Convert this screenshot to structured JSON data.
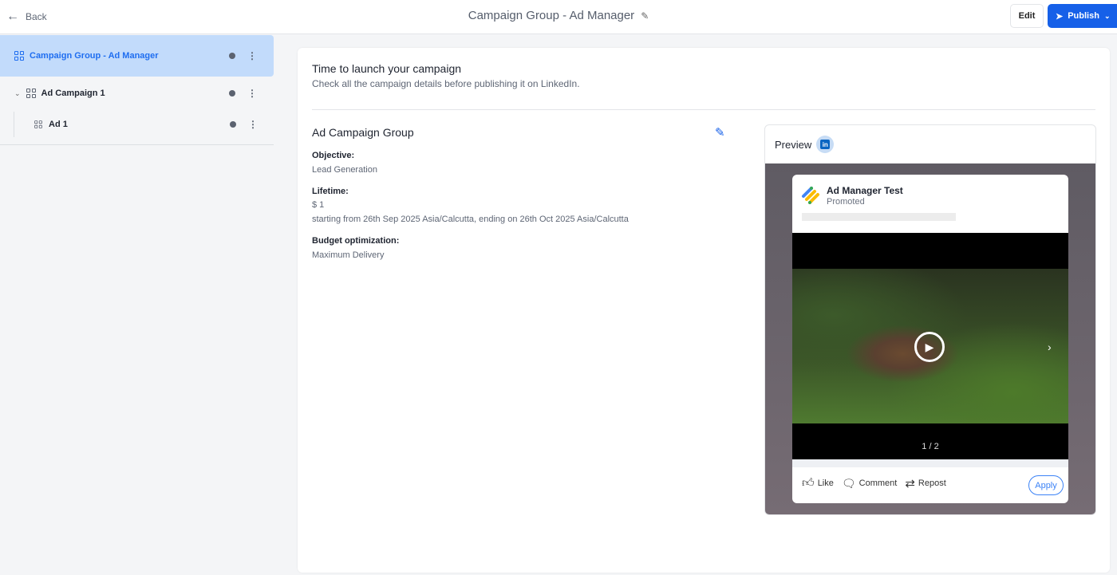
{
  "header": {
    "back_label": "Back",
    "title": "Campaign Group - Ad Manager",
    "edit_label": "Edit",
    "publish_label": "Publish"
  },
  "sidebar": {
    "items": [
      {
        "label": "Campaign Group - Ad Manager"
      },
      {
        "label": "Ad Campaign 1"
      },
      {
        "label": "Ad 1"
      }
    ]
  },
  "main": {
    "heading": "Time to launch your campaign",
    "subheading": "Check all the campaign details before publishing it on LinkedIn.",
    "section_title": "Ad Campaign Group",
    "fields": [
      {
        "label": "Objective:",
        "values": [
          "Lead Generation"
        ]
      },
      {
        "label": "Lifetime:",
        "values": [
          "$ 1",
          "starting from 26th Sep 2025 Asia/Calcutta, ending on 26th Oct 2025 Asia/Calcutta"
        ]
      },
      {
        "label": "Budget optimization:",
        "values": [
          "Maximum Delivery"
        ]
      }
    ]
  },
  "preview": {
    "title": "Preview",
    "network": "in",
    "company": "Ad Manager Test",
    "promoted": "Promoted",
    "counter": "1 / 2",
    "actions": {
      "like": "Like",
      "comment": "Comment",
      "repost": "Repost",
      "apply": "Apply"
    }
  },
  "colors": {
    "accent": "#1660e8",
    "selected_bg": "#c2dbfb"
  }
}
